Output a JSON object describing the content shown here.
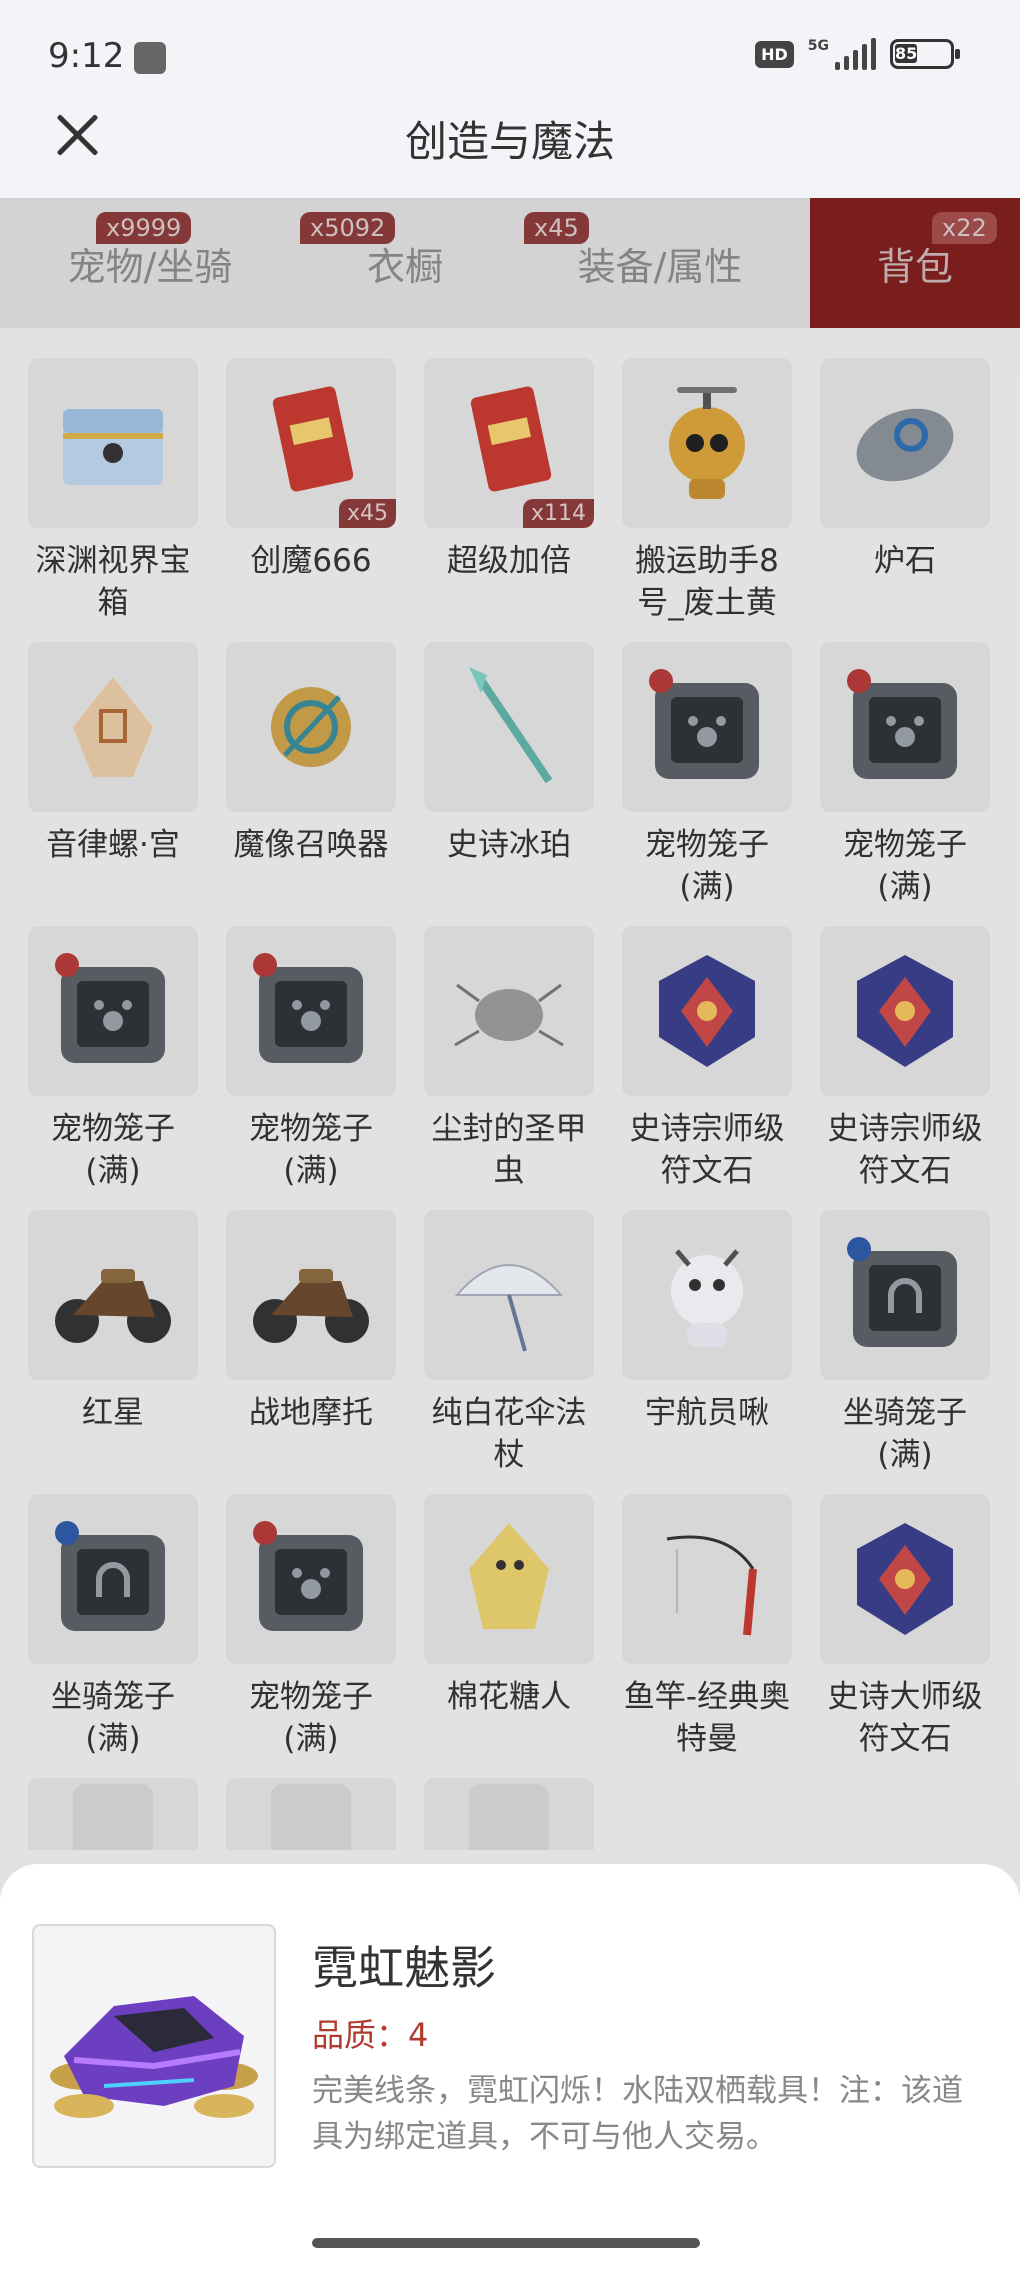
{
  "status": {
    "time": "9:12",
    "hd": "HD",
    "network": "5G",
    "battery": "85"
  },
  "header": {
    "title": "创造与魔法"
  },
  "tabs": [
    {
      "label": "宠物/坐骑",
      "badge": "x9999"
    },
    {
      "label": "衣橱",
      "badge": "x5092"
    },
    {
      "label": "装备/属性",
      "badge": "x45"
    },
    {
      "label": "背包",
      "badge": "x22"
    }
  ],
  "items": [
    {
      "name": "深渊视界宝箱",
      "qty": "",
      "icon": "chest-icon"
    },
    {
      "name": "创魔666",
      "qty": "x45",
      "icon": "card-icon"
    },
    {
      "name": "超级加倍",
      "qty": "x114",
      "icon": "card-icon"
    },
    {
      "name": "搬运助手8号_废土黄",
      "qty": "",
      "icon": "robot-icon"
    },
    {
      "name": "炉石",
      "qty": "",
      "icon": "stone-icon"
    },
    {
      "name": "音律螺·宫",
      "qty": "",
      "icon": "shell-icon"
    },
    {
      "name": "魔像召唤器",
      "qty": "",
      "icon": "summoner-icon"
    },
    {
      "name": "史诗冰珀",
      "qty": "",
      "icon": "spear-icon"
    },
    {
      "name": "宠物笼子(满)",
      "qty": "",
      "icon": "pet-cage-icon"
    },
    {
      "name": "宠物笼子(满)",
      "qty": "",
      "icon": "pet-cage-icon"
    },
    {
      "name": "宠物笼子(满)",
      "qty": "",
      "icon": "pet-cage-icon"
    },
    {
      "name": "宠物笼子(满)",
      "qty": "",
      "icon": "pet-cage-icon"
    },
    {
      "name": "尘封的圣甲虫",
      "qty": "",
      "icon": "beetle-icon"
    },
    {
      "name": "史诗宗师级符文石",
      "qty": "",
      "icon": "rune-icon"
    },
    {
      "name": "史诗宗师级符文石",
      "qty": "",
      "icon": "rune-icon"
    },
    {
      "name": "红星",
      "qty": "",
      "icon": "motorcycle-icon"
    },
    {
      "name": "战地摩托",
      "qty": "",
      "icon": "motorcycle-icon"
    },
    {
      "name": "纯白花伞法杖",
      "qty": "",
      "icon": "umbrella-icon"
    },
    {
      "name": "宇航员啾",
      "qty": "",
      "icon": "astronaut-icon"
    },
    {
      "name": "坐骑笼子(满)",
      "qty": "",
      "icon": "mount-cage-icon"
    },
    {
      "name": "坐骑笼子(满)",
      "qty": "",
      "icon": "mount-cage-icon"
    },
    {
      "name": "宠物笼子(满)",
      "qty": "",
      "icon": "pet-cage-icon"
    },
    {
      "name": "棉花糖人",
      "qty": "",
      "icon": "marshmallow-icon"
    },
    {
      "name": "鱼竿-经典奥特曼",
      "qty": "",
      "icon": "fishing-rod-icon"
    },
    {
      "name": "史诗大师级符文石",
      "qty": "",
      "icon": "rune-icon"
    },
    {
      "name": "",
      "qty": "",
      "icon": "partial-item-icon"
    },
    {
      "name": "",
      "qty": "",
      "icon": "partial-item-icon"
    },
    {
      "name": "",
      "qty": "",
      "icon": "partial-item-icon"
    }
  ],
  "detail": {
    "title": "霓虹魅影",
    "quality": "品质：4",
    "description": "完美线条，霓虹闪烁！水陆双栖载具！注：该道具为绑定道具，不可与他人交易。",
    "icon": "neon-car-icon"
  }
}
